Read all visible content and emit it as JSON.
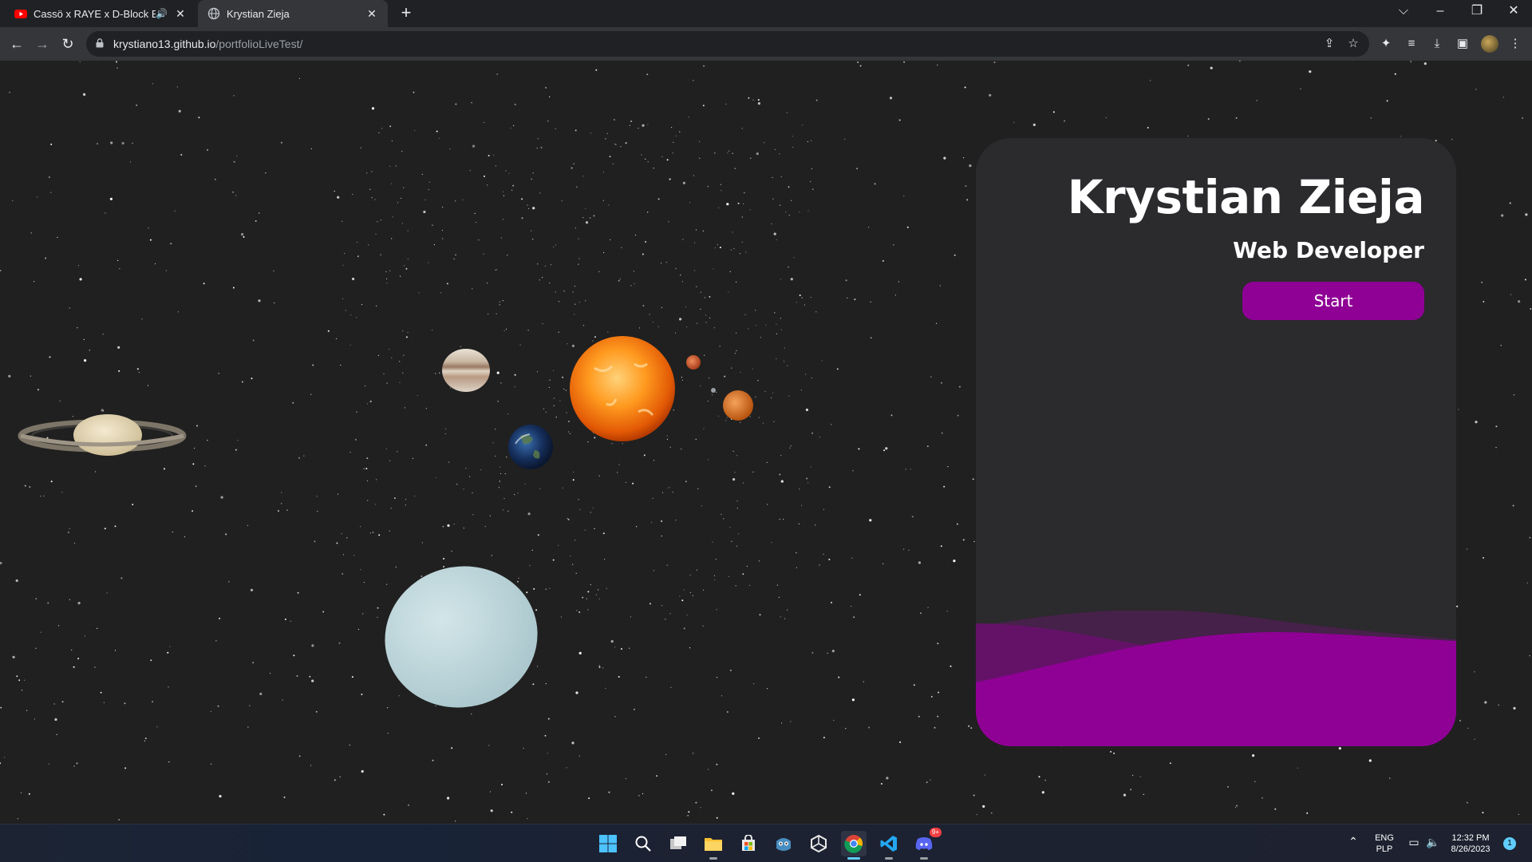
{
  "browser": {
    "tabs": [
      {
        "title": "Cassö x RAYE x D-Block Europ",
        "favicon": "youtube-icon",
        "audio": true,
        "active": false
      },
      {
        "title": "Krystian Zieja",
        "favicon": "globe-icon",
        "active": true
      }
    ],
    "address": {
      "host": "krystiano13.github.io",
      "path": "/portfolioLiveTest/"
    }
  },
  "page": {
    "card": {
      "name": "Krystian Zieja",
      "role": "Web Developer",
      "button_label": "Start"
    },
    "colors": {
      "accent": "#8f0095",
      "card_bg": "#2b2a2d",
      "space_bg": "#202020"
    },
    "scene_objects": [
      "saturn",
      "jupiter",
      "earth",
      "sun",
      "mercury",
      "mars",
      "venus",
      "uranus"
    ]
  },
  "taskbar": {
    "apps": [
      "windows-start-icon",
      "search-icon",
      "task-view-icon",
      "file-explorer-icon",
      "microsoft-store-icon",
      "godot-icon",
      "unity-icon",
      "chrome-icon",
      "vscode-icon",
      "discord-icon"
    ],
    "discord_badge": "9+",
    "language": {
      "line1": "ENG",
      "line2": "PLP"
    },
    "clock": {
      "time": "12:32 PM",
      "date": "8/26/2023"
    },
    "notifications": "1"
  }
}
